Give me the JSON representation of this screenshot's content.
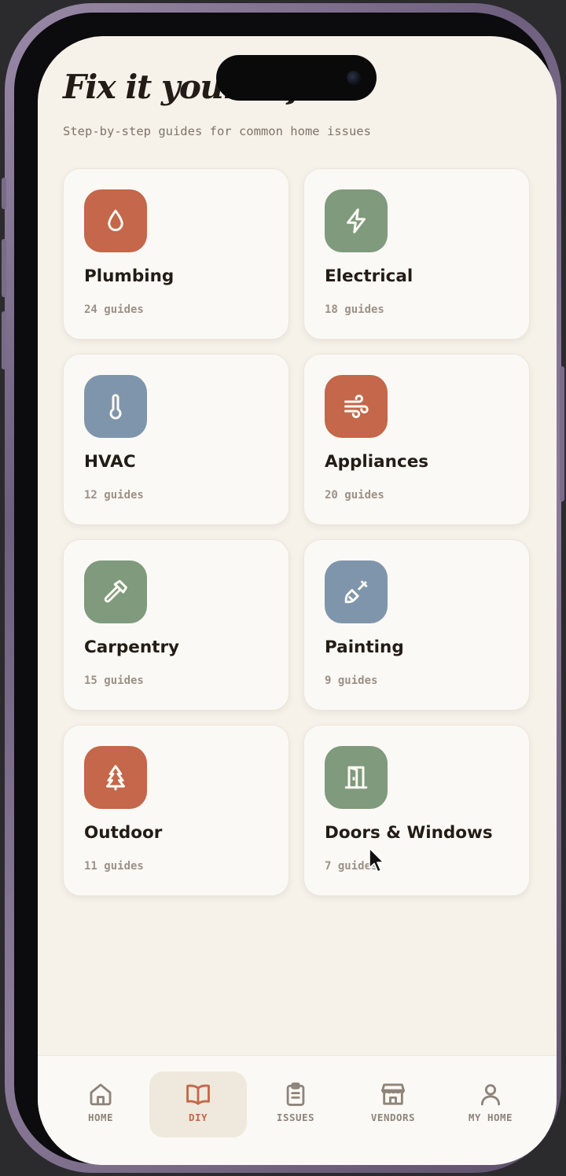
{
  "header": {
    "title": "Fix it yourself",
    "subtitle": "Step-by-step guides for common home issues"
  },
  "categories": [
    {
      "name": "Plumbing",
      "count": "24 guides",
      "icon": "water-drop-icon",
      "color": "#c4674a"
    },
    {
      "name": "Electrical",
      "count": "18 guides",
      "icon": "lightning-bolt-icon",
      "color": "#7f9a7d"
    },
    {
      "name": "HVAC",
      "count": "12 guides",
      "icon": "thermometer-icon",
      "color": "#7f95ab"
    },
    {
      "name": "Appliances",
      "count": "20 guides",
      "icon": "wind-icon",
      "color": "#c4674a"
    },
    {
      "name": "Carpentry",
      "count": "15 guides",
      "icon": "hammer-icon",
      "color": "#7f9a7d"
    },
    {
      "name": "Painting",
      "count": "9 guides",
      "icon": "paintbrush-icon",
      "color": "#7f95ab"
    },
    {
      "name": "Outdoor",
      "count": "11 guides",
      "icon": "pine-tree-icon",
      "color": "#c4674a"
    },
    {
      "name": "Doors & Windows",
      "count": "7 guides",
      "icon": "door-icon",
      "color": "#7f9a7d"
    }
  ],
  "nav": {
    "items": [
      {
        "label": "HOME",
        "icon": "house-icon"
      },
      {
        "label": "DIY",
        "icon": "open-book-icon",
        "active": true
      },
      {
        "label": "ISSUES",
        "icon": "clipboard-icon"
      },
      {
        "label": "VENDORS",
        "icon": "storefront-icon"
      },
      {
        "label": "MY HOME",
        "icon": "user-icon"
      }
    ],
    "active_color": "#c4674a",
    "inactive_color": "#8e847a"
  },
  "theme": {
    "background": "#f6f2ea",
    "card_background": "#fbf9f5",
    "text_primary": "#231c16",
    "text_secondary": "#9c9186"
  }
}
